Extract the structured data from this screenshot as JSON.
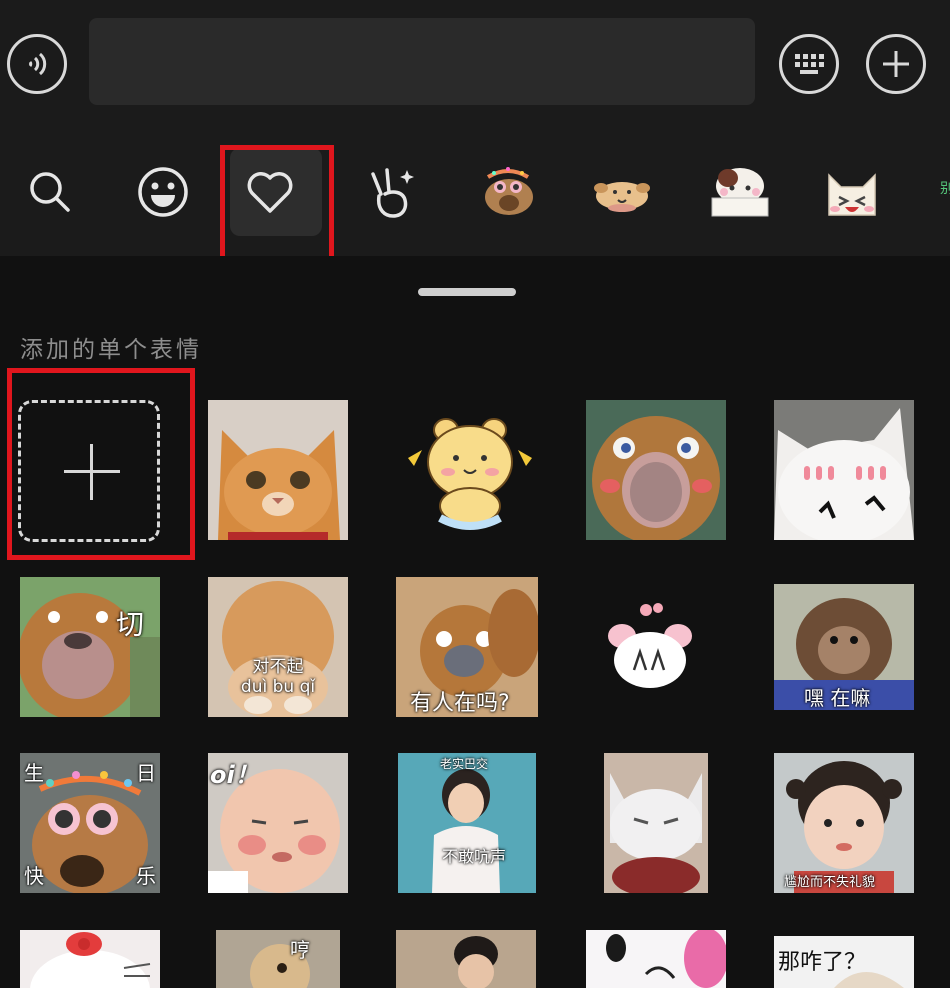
{
  "input_bar": {
    "voice_icon": "voice-wave-icon",
    "text_value": "",
    "keyboard_icon": "keyboard-icon",
    "plus_icon": "plus-icon"
  },
  "tabs": [
    {
      "name": "search",
      "icon": "search-icon"
    },
    {
      "name": "emoji",
      "icon": "smiley-icon"
    },
    {
      "name": "favorites",
      "icon": "heart-icon",
      "selected": true
    },
    {
      "name": "gestures",
      "icon": "victory-hand-icon"
    },
    {
      "name": "birthday-dog-pack",
      "icon": "sticker-pack-thumb"
    },
    {
      "name": "cream-dog-pack",
      "icon": "sticker-pack-thumb"
    },
    {
      "name": "bear-in-box-pack",
      "icon": "sticker-pack-thumb"
    },
    {
      "name": "white-cat-pack",
      "icon": "sticker-pack-thumb"
    }
  ],
  "panel": {
    "section_title": "添加的单个表情",
    "add_icon": "plus-icon"
  },
  "stickers": [
    {
      "caption": ""
    },
    {
      "caption": ""
    },
    {
      "caption": ""
    },
    {
      "caption": ""
    },
    {
      "caption": "切"
    },
    {
      "caption": "对不起\nduì bu qǐ"
    },
    {
      "caption": "有人在吗?"
    },
    {
      "caption": ""
    },
    {
      "caption": "嘿 在嘛"
    },
    {
      "caption": "生 日 快 乐"
    },
    {
      "caption": "oi！"
    },
    {
      "caption": "不敢吭声",
      "caption_top": "老实巴交"
    },
    {
      "caption": ""
    },
    {
      "caption": "尴尬而不失礼貌"
    },
    {
      "caption": ""
    },
    {
      "caption": "哼"
    },
    {
      "caption": ""
    },
    {
      "caption": ""
    },
    {
      "caption": "那咋了？"
    }
  ],
  "colors": {
    "highlight": "#e0161d",
    "bar_bg": "#1b1b1b",
    "panel_bg": "#111111"
  }
}
